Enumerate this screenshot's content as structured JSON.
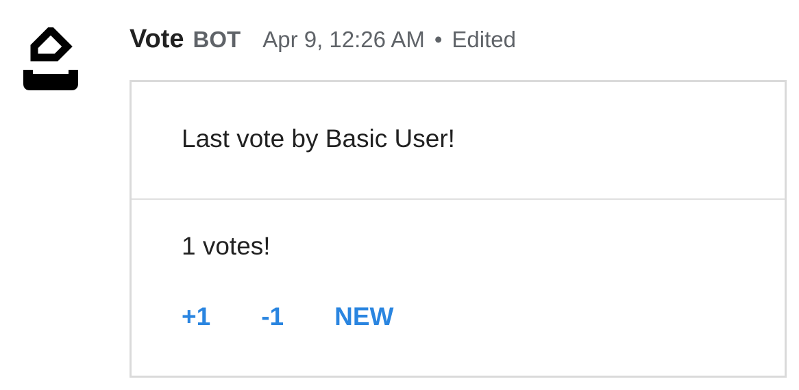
{
  "message": {
    "avatar_icon": "ballot-box-icon",
    "sender": "Vote",
    "bot_tag": "BOT",
    "timestamp": "Apr 9, 12:26 AM",
    "separator": "•",
    "edited_label": "Edited"
  },
  "card": {
    "last_vote_text": "Last vote by Basic User!",
    "vote_count_text": "1 votes!",
    "buttons": {
      "plus": "+1",
      "minus": "-1",
      "new": "NEW"
    },
    "accent_color": "#2a85e0"
  }
}
